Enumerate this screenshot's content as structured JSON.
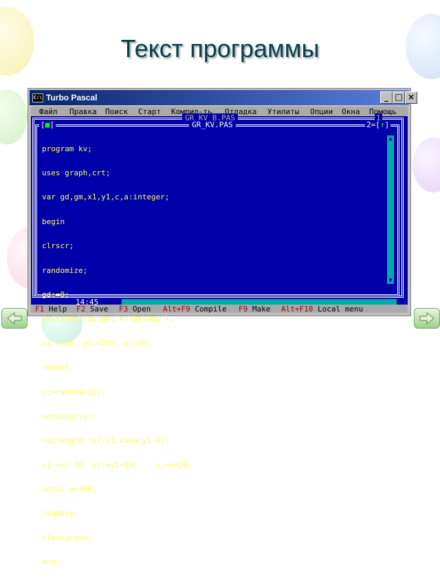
{
  "slide": {
    "title": "Текст программы"
  },
  "window": {
    "title": "Turbo Pascal",
    "icon": "C:\\",
    "buttons": {
      "minimize": "_",
      "maximize": "□",
      "close": "×"
    }
  },
  "menu": [
    {
      "label": "Файл"
    },
    {
      "label": "Правка"
    },
    {
      "label": "Поиск"
    },
    {
      "label": "Старт"
    },
    {
      "label": "Компил-ть"
    },
    {
      "label": "Отладка"
    },
    {
      "label": "Утилиты"
    },
    {
      "label": "Опции"
    },
    {
      "label": "Окна"
    },
    {
      "label": "Помощь"
    }
  ],
  "editor": {
    "back_window_title": "GR_KV_B.PAS",
    "back_window_num": "1",
    "window_title": "GR_KV.PAS",
    "close_mark": "[■]",
    "window_num": "2=[↑]",
    "code_lines": [
      "program kv;",
      "uses graph,crt;",
      "var gd,gm,x1,y1,c,a:integer;",
      "begin",
      "clrscr;",
      "randomize;",
      "gd:=0;",
      "initgraph(gd,gm,'c:\\bp\\bgi');",
      "x1:=310; y1:=230; a:=20;",
      "repeat",
      "c:=random(15);",
      "setcolor(c);",
      "rectangle (x1,y1,x1+a,y1-a);",
      "x1:=x1-10; y1:=y1+10;    a:=a+20;",
      "until a>400;",
      "readkey;",
      "closegraph;",
      "end."
    ],
    "cursor_pos": "14:45"
  },
  "fkeys": [
    {
      "key": "F1",
      "label": "Help"
    },
    {
      "key": "F2",
      "label": "Save"
    },
    {
      "key": "F3",
      "label": "Open"
    },
    {
      "key": "Alt+F9",
      "label": "Compile"
    },
    {
      "key": "F9",
      "label": "Make"
    },
    {
      "key": "Alt+F10",
      "label": "Local menu"
    }
  ],
  "nav": {
    "prev_icon": "arrow-left-icon",
    "next_icon": "arrow-right-icon"
  }
}
